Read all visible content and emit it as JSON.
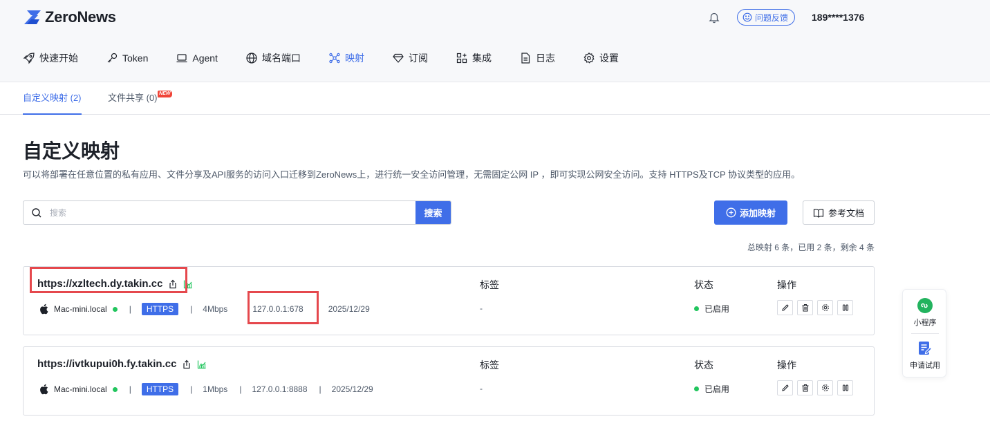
{
  "brand": {
    "name": "ZeroNews"
  },
  "header": {
    "feedback_label": "问题反馈",
    "user": "189****1376"
  },
  "nav": [
    {
      "label": "快速开始",
      "icon": "rocket-icon"
    },
    {
      "label": "Token",
      "icon": "key-icon"
    },
    {
      "label": "Agent",
      "icon": "laptop-icon"
    },
    {
      "label": "域名端口",
      "icon": "globe-icon"
    },
    {
      "label": "映射",
      "icon": "mapping-icon",
      "active": true
    },
    {
      "label": "订阅",
      "icon": "diamond-icon"
    },
    {
      "label": "集成",
      "icon": "apps-icon"
    },
    {
      "label": "日志",
      "icon": "document-icon"
    },
    {
      "label": "设置",
      "icon": "gear-icon"
    }
  ],
  "subtabs": [
    {
      "label": "自定义映射 (2)",
      "active": true
    },
    {
      "label": "文件共享 (0)",
      "badge": "NEW"
    }
  ],
  "page": {
    "title": "自定义映射",
    "description": "可以将部署在任意位置的私有应用、文件分享及API服务的访问入口迁移到ZeroNews上，进行统一安全访问管理，无需固定公网 IP ，即可实现公网安全访问。支持 HTTPS及TCP 协议类型的应用。"
  },
  "search": {
    "placeholder": "搜索",
    "value": "",
    "button_label": "搜索"
  },
  "actions": {
    "add_label": "添加映射",
    "doc_label": "参考文档"
  },
  "quota_text": "总映射 6 条，已用 2 条，剩余 4 条",
  "columns": {
    "tag": "标签",
    "status": "状态",
    "ops": "操作"
  },
  "mappings": [
    {
      "url": "https://xzltech.dy.takin.cc",
      "host": "Mac-mini.local",
      "protocol": "HTTPS",
      "bandwidth": "4Mbps",
      "target": "127.0.0.1:678",
      "date": "2025/12/29",
      "tag": "-",
      "status": "已启用"
    },
    {
      "url": "https://ivtkupui0h.fy.takin.cc",
      "host": "Mac-mini.local",
      "protocol": "HTTPS",
      "bandwidth": "1Mbps",
      "target": "127.0.0.1:8888",
      "date": "2025/12/29",
      "tag": "-",
      "status": "已启用"
    }
  ],
  "floating": {
    "miniprogram_label": "小程序",
    "trial_label": "申请试用"
  },
  "colors": {
    "accent": "#3f6ee8",
    "success": "#22c55e",
    "highlight": "#e5484d"
  }
}
